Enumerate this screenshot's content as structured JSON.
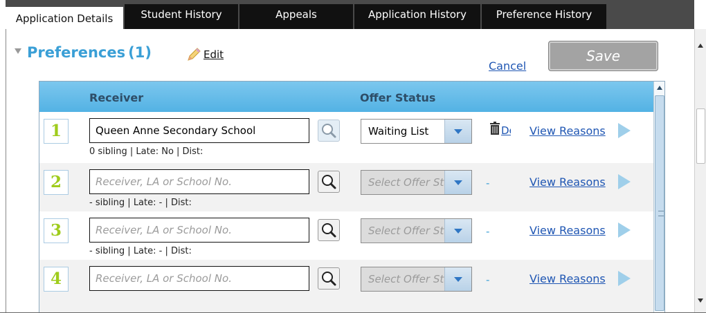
{
  "tabs": [
    {
      "label": "Application Details",
      "active": true
    },
    {
      "label": "Student History",
      "active": false
    },
    {
      "label": "Appeals",
      "active": false
    },
    {
      "label": "Application History",
      "active": false
    },
    {
      "label": "Preference History",
      "active": false
    }
  ],
  "section": {
    "title": "Preferences",
    "count": "(1)",
    "edit_label": "Edit"
  },
  "actions": {
    "cancel_label": "Cancel",
    "save_label": "Save"
  },
  "table": {
    "headers": {
      "receiver": "Receiver",
      "offer_status": "Offer Status"
    },
    "rows": [
      {
        "number": "1",
        "receiver_value": "Queen Anne Secondary School",
        "receiver_placeholder": "",
        "offer_value": "Waiting List",
        "offer_placeholder": "",
        "delete_label": "Delete",
        "meta": "0 sibling | Late: No | Dist:",
        "view_reasons": "View Reasons"
      },
      {
        "number": "2",
        "receiver_value": "",
        "receiver_placeholder": "Receiver, LA or School No.",
        "offer_value": "",
        "offer_placeholder": "Select Offer Status",
        "dash": "-",
        "meta": "- sibling | Late: - | Dist:",
        "view_reasons": "View Reasons"
      },
      {
        "number": "3",
        "receiver_value": "",
        "receiver_placeholder": "Receiver, LA or School No.",
        "offer_value": "",
        "offer_placeholder": "Select Offer Status",
        "dash": "-",
        "meta": "- sibling | Late: - | Dist:",
        "view_reasons": "View Reasons"
      },
      {
        "number": "4",
        "receiver_value": "",
        "receiver_placeholder": "Receiver, LA or School No.",
        "offer_value": "",
        "offer_placeholder": "Select Offer Status",
        "dash": "-",
        "meta": "",
        "view_reasons": "View Reasons"
      }
    ]
  },
  "colors": {
    "accent_blue": "#3a9fd6",
    "link_blue": "#1f56b3",
    "number_green": "#9fcc1c",
    "header_gradient_top": "#7cc7ee",
    "header_gradient_bottom": "#53b2e4"
  }
}
